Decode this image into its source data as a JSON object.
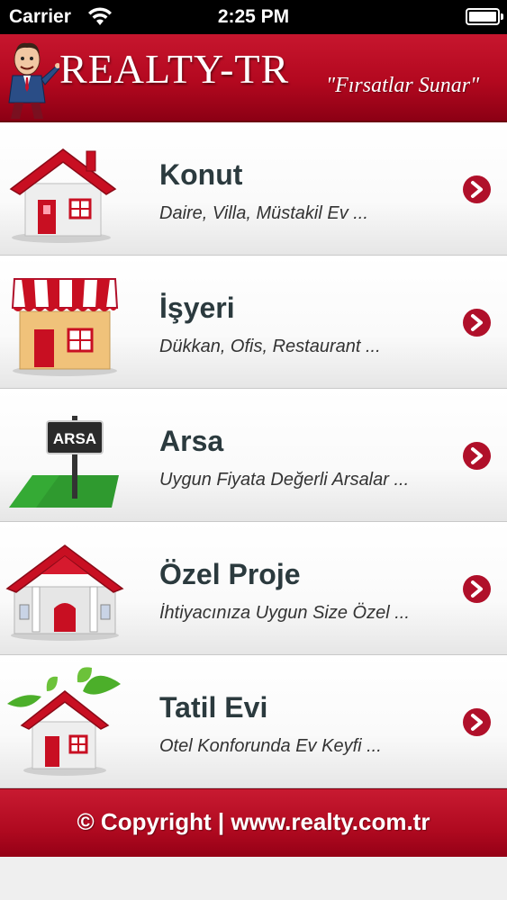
{
  "status_bar": {
    "carrier": "Carrier",
    "time": "2:25 PM"
  },
  "header": {
    "brand": "REALTY-TR",
    "tagline": "\"Fırsatlar Sunar\""
  },
  "menu": [
    {
      "title": "Konut",
      "subtitle": "Daire, Villa, Müstakil Ev ...",
      "icon": "house-icon"
    },
    {
      "title": "İşyeri",
      "subtitle": "Dükkan, Ofis, Restaurant ...",
      "icon": "shop-icon"
    },
    {
      "title": "Arsa",
      "subtitle": "Uygun Fiyata Değerli Arsalar ...",
      "icon": "land-sign-icon",
      "sign_text": "ARSA"
    },
    {
      "title": "Özel Proje",
      "subtitle": "İhtiyacınıza Uygun Size Özel ...",
      "icon": "villa-icon"
    },
    {
      "title": "Tatil Evi",
      "subtitle": "Otel Konforunda Ev Keyfi ...",
      "icon": "holiday-house-icon"
    }
  ],
  "footer": {
    "copyright": "© Copyright | www.realty.com.tr"
  },
  "colors": {
    "brand_red": "#b3081f",
    "title_text": "#2b3a3e",
    "chevron": "#b0102a"
  }
}
